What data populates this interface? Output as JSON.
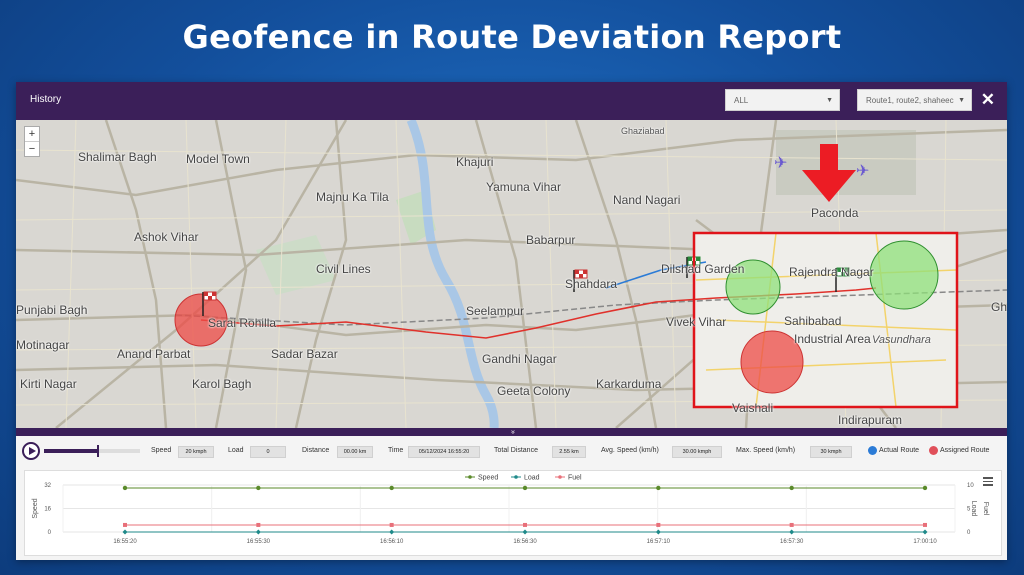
{
  "headline": "Geofence in Route Deviation Report",
  "window": {
    "title": "History",
    "filter_select": "ALL",
    "route_select": "Route1, route2, shaheec"
  },
  "map": {
    "zoom_in": "+",
    "zoom_out": "−",
    "places": [
      "Shalimar Bagh",
      "Model Town",
      "Khajuri",
      "Ghaziabad",
      "Yamuna Vihar",
      "Majnu Ka Tila",
      "Nand Nagari",
      "Ashok Vihar",
      "Babarpur",
      "Paconda",
      "Civil Lines",
      "Shahdara",
      "Dilshad Garden",
      "Rajendra Nagar",
      "Punjabi Bagh",
      "Sarai Rohilla",
      "Seelampur",
      "Vivek Vihar",
      "Sahibabad",
      "Motinagar",
      "Anand Parbat",
      "Sadar Bazar",
      "Gandhi Nagar",
      "Industrial Area",
      "Vasundhara",
      "Kirti Nagar",
      "Karol Bagh",
      "Geeta Colony",
      "Karkarduma",
      "Vaishali",
      "Indirapuram",
      "Gh"
    ],
    "accent_colors": {
      "route_actual": "#e0312b",
      "route_assigned": "#2b7bd6",
      "geofence_green": "#8fe07a",
      "geofence_red": "#ee4b45",
      "highlight_box": "#e0141a",
      "arrow": "#ec1c24"
    }
  },
  "collapse_icon": "»",
  "controls": {
    "speed_label": "Speed",
    "speed_value": "20 kmph",
    "load_label": "Load",
    "load_value": "0",
    "distance_label": "Distance",
    "distance_value": "00.00 km",
    "time_label": "Time",
    "time_value": "05/12/2024 16:55:20",
    "total_distance_label": "Total Distance",
    "total_distance_value": "2.55 km",
    "avg_speed_label": "Avg. Speed (km/h)",
    "avg_speed_value": "30.00 kmph",
    "max_speed_label": "Max. Speed (km/h)",
    "max_speed_value": "30 kmph",
    "actual_route_label": "Actual Route",
    "assigned_route_label": "Assigned Route",
    "playback_progress": 0.55
  },
  "chart_data": {
    "type": "line",
    "x": [
      "16:55:20",
      "16:55:30",
      "16:56:10",
      "16:56:30",
      "16:57:10",
      "16:57:30",
      "17:00:10"
    ],
    "series": [
      {
        "name": "Speed",
        "axis": "left",
        "values": [
          30,
          30,
          30,
          30,
          30,
          30,
          30
        ],
        "color": "#5a8a2a"
      },
      {
        "name": "Load",
        "axis": "right",
        "values": [
          0,
          0,
          0,
          0,
          0,
          0,
          0
        ],
        "color": "#1f8a8a"
      },
      {
        "name": "Fuel",
        "axis": "right",
        "values": [
          1.5,
          1.5,
          1.5,
          1.5,
          1.5,
          1.5,
          1.5
        ],
        "color": "#e8707a"
      }
    ],
    "left_axis": {
      "label": "Speed",
      "ticks": [
        "32",
        "16",
        "0"
      ],
      "range": [
        0,
        32
      ]
    },
    "right_axis": {
      "labels": [
        "Load",
        "Fuel"
      ],
      "ticks": [
        "10",
        "5",
        "0"
      ],
      "range": [
        0,
        10
      ]
    },
    "legend_position": "top",
    "grid": true
  }
}
